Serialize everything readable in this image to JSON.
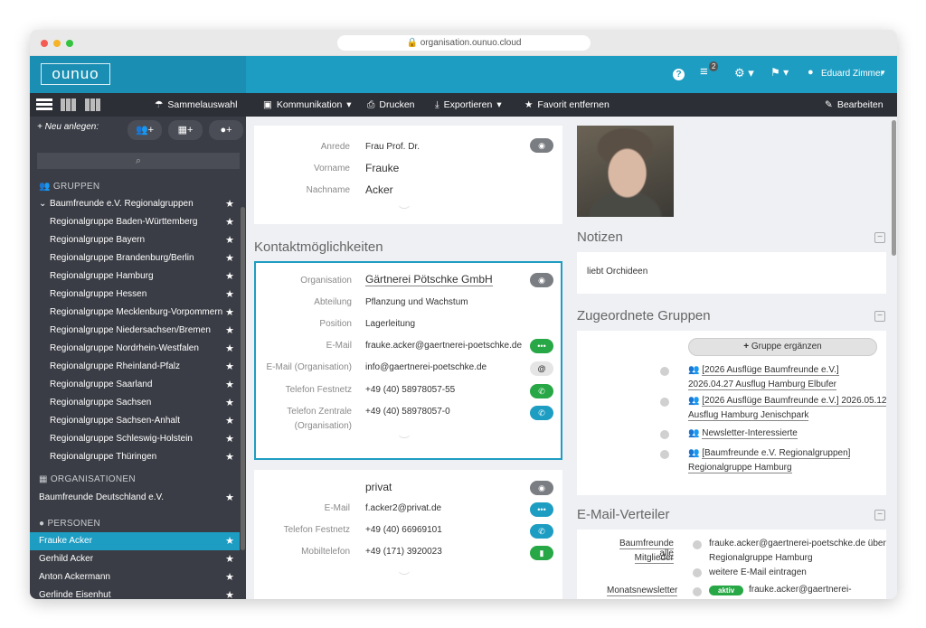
{
  "browser": {
    "url": "organisation.ounuo.cloud"
  },
  "header": {
    "logo": "ounuo",
    "menu_badge": "2",
    "user": "Eduard Zimmer"
  },
  "toolbar": {
    "sammelauswahl": "Sammelauswahl",
    "kommunikation": "Kommunikation",
    "drucken": "Drucken",
    "exportieren": "Exportieren",
    "favorit": "Favorit entfernen",
    "bearbeiten": "Bearbeiten"
  },
  "sidebar": {
    "neu_anlegen": "Neu anlegen:",
    "groups_title": "GRUPPEN",
    "group_parent": "Baumfreunde e.V. Regionalgruppen",
    "groups": [
      "Regionalgruppe Baden-Württemberg",
      "Regionalgruppe Bayern",
      "Regionalgruppe Brandenburg/Berlin",
      "Regionalgruppe Hamburg",
      "Regionalgruppe Hessen",
      "Regionalgruppe Mecklenburg-Vorpommern",
      "Regionalgruppe Niedersachsen/Bremen",
      "Regionalgruppe Nordrhein-Westfalen",
      "Regionalgruppe Rheinland-Pfalz",
      "Regionalgruppe Saarland",
      "Regionalgruppe Sachsen",
      "Regionalgruppe Sachsen-Anhalt",
      "Regionalgruppe Schleswig-Holstein",
      "Regionalgruppe Thüringen"
    ],
    "orgs_title": "ORGANISATIONEN",
    "orgs": [
      "Baumfreunde Deutschland e.V."
    ],
    "persons_title": "PERSONEN",
    "persons": [
      "Frauke Acker",
      "Gerhild Acker",
      "Anton Ackermann",
      "Gerlinde Eisenhut"
    ]
  },
  "person": {
    "anrede_label": "Anrede",
    "anrede": "Frau Prof. Dr.",
    "vorname_label": "Vorname",
    "vorname": "Frauke",
    "nachname_label": "Nachname",
    "nachname": "Acker"
  },
  "kontakt": {
    "title": "Kontaktmöglichkeiten",
    "org_label": "Organisation",
    "org": "Gärtnerei Pötschke GmbH",
    "abt_label": "Abteilung",
    "abt": "Pflanzung und Wachstum",
    "pos_label": "Position",
    "pos": "Lagerleitung",
    "email_label": "E-Mail",
    "email": "frauke.acker@gaertnerei-poetschke.de",
    "email_org_label": "E-Mail (Organisation)",
    "email_org": "info@gaertnerei-poetschke.de",
    "tel_label": "Telefon Festnetz",
    "tel": "+49 (40) 58978057-55",
    "tel_z_label": "Telefon Zentrale",
    "tel_z_label2": "(Organisation)",
    "tel_z": "+49 (40) 58978057-0"
  },
  "privat": {
    "title": "privat",
    "email_label": "E-Mail",
    "email": "f.acker2@privat.de",
    "tel_label": "Telefon Festnetz",
    "tel": "+49 (40) 66969101",
    "mobil_label": "Mobiltelefon",
    "mobil": "+49 (171) 3920023"
  },
  "notizen": {
    "title": "Notizen",
    "text": "liebt Orchideen"
  },
  "gruppen": {
    "title": "Zugeordnete Gruppen",
    "add_button": "Gruppe ergänzen",
    "items": [
      {
        "line1": "[2026 Ausflüge Baumfreunde e.V.]",
        "line2": "2026.04.27 Ausflug Hamburg Elbufer"
      },
      {
        "line1": "[2026 Ausflüge Baumfreunde e.V.]  2026.05.12",
        "line2": "Ausflug Hamburg Jenischpark"
      },
      {
        "line1": "Newsletter-Interessierte",
        "line2": ""
      },
      {
        "line1": "[Baumfreunde e.V. Regionalgruppen]",
        "line2": "Regionalgruppe Hamburg"
      }
    ]
  },
  "verteiler": {
    "title": "E-Mail-Verteiler",
    "list1_name1": "Baumfreunde alle",
    "list1_name2": "Mitglieder",
    "list1_addr1": "frauke.acker@gaertnerei-poetschke.de über",
    "list1_addr2": "Regionalgruppe Hamburg",
    "list1_more": "weitere E-Mail eintragen",
    "list2_name": "Monatsnewsletter",
    "list2_badge": "aktiv",
    "list2_addr": "frauke.acker@gaertnerei-"
  },
  "colors": {
    "primary": "#1e9dc2",
    "sidebar": "#3a3d45",
    "active": "#1e9dc2",
    "green": "#27a745"
  }
}
